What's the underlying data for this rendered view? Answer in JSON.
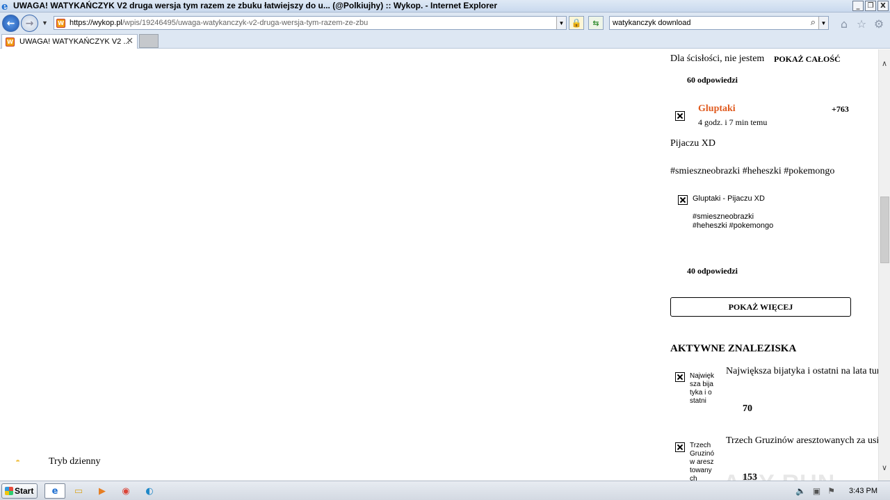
{
  "window": {
    "title": "UWAGA! WATYKAŃCZYK V2 druga wersja tym razem ze zbuku łatwiejszy do u... (@Polkiujhy) :: Wykop. - Internet Explorer",
    "btn_min": "_",
    "btn_restore": "❐",
    "btn_close": "X"
  },
  "browser": {
    "url_domain": "https://wykop.pl",
    "url_path": "/wpis/19246495/uwaga-watykanczyk-v2-druga-wersja-tym-razem-ze-zbu",
    "search_query": "watykanczyk download",
    "tab_label": "UWAGA! WATYKAŃCZYK V2 ...",
    "icons": {
      "back": "back-arrow-icon",
      "forward": "forward-arrow-icon",
      "lock": "padlock-icon",
      "refresh": "refresh-icon",
      "search": "magnifier-icon",
      "home": "home-icon",
      "favorites": "star-icon",
      "tools": "gear-icon"
    }
  },
  "page": {
    "night_mode_label": "Tryb dzienny",
    "top_snippet": "Dla ścisłości, nie jestem",
    "show_all": "POKAŻ CAŁOŚĆ",
    "replies_1": "60 odpowiedzi",
    "post": {
      "author": "Gluptaki",
      "author_color": "#e05a1e",
      "time": "4 godz. i 7 min temu",
      "score": "+763",
      "text": "Pijaczu XD",
      "tags": "#smieszneobrazki #heheszki #pokemongo",
      "embed_title": "Gluptaki - Pijaczu XD",
      "embed_tags_1": "#smieszneobrazki",
      "embed_tags_2": "#heheszki #pokemongo"
    },
    "replies_2": "40 odpowiedzi",
    "show_more": "POKAŻ WIĘCEJ",
    "active_heading": "AKTYWNE ZNALEZISKA",
    "findings": [
      {
        "thumb_alt": "Największa bijatyka i ostatni",
        "title": "Największa bijatyka i ostatni na lata tur",
        "votes": "70"
      },
      {
        "thumb_alt": "Trzech Gruzinów aresztowanych",
        "title": "Trzech Gruzinów aresztowanych za usi",
        "votes": "153"
      }
    ]
  },
  "taskbar": {
    "start_label": "Start",
    "clock": "3:43 PM"
  },
  "watermark": "ANY RUN"
}
